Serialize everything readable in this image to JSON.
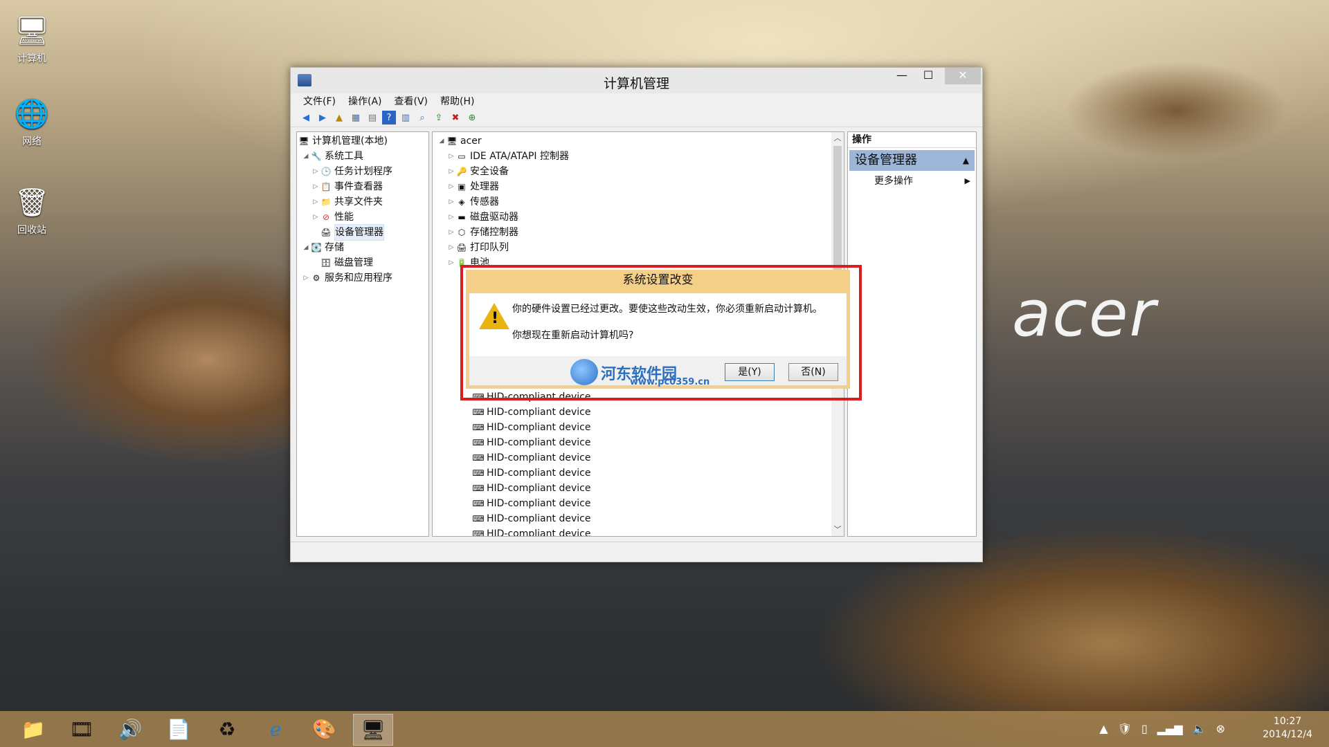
{
  "desktop": {
    "icons": [
      {
        "label": "计算机"
      },
      {
        "label": "网络"
      },
      {
        "label": "回收站"
      }
    ],
    "brand_logo": "acer"
  },
  "window": {
    "title": "计算机管理",
    "menu": [
      "文件(F)",
      "操作(A)",
      "查看(V)",
      "帮助(H)"
    ],
    "left_tree": [
      {
        "label": "计算机管理(本地)",
        "level": 0,
        "arrow": ""
      },
      {
        "label": "系统工具",
        "level": 1,
        "arrow": "◢"
      },
      {
        "label": "任务计划程序",
        "level": 2,
        "arrow": "▷"
      },
      {
        "label": "事件查看器",
        "level": 2,
        "arrow": "▷"
      },
      {
        "label": "共享文件夹",
        "level": 2,
        "arrow": "▷"
      },
      {
        "label": "性能",
        "level": 2,
        "arrow": "▷"
      },
      {
        "label": "设备管理器",
        "level": 2,
        "arrow": "",
        "selected": true
      },
      {
        "label": "存储",
        "level": 1,
        "arrow": "◢"
      },
      {
        "label": "磁盘管理",
        "level": 2,
        "arrow": ""
      },
      {
        "label": "服务和应用程序",
        "level": 1,
        "arrow": "▷"
      }
    ],
    "device_tree_root": "acer",
    "device_categories": [
      "IDE ATA/ATAPI 控制器",
      "安全设备",
      "处理器",
      "传感器",
      "磁盘驱动器",
      "存储控制器",
      "打印队列",
      "电池"
    ],
    "hid_devices": [
      "HID-compliant device",
      "HID-compliant device",
      "HID-compliant device",
      "HID-compliant device",
      "HID-compliant device",
      "HID-compliant device",
      "HID-compliant device",
      "HID-compliant device",
      "HID-compliant device",
      "HID-compliant device"
    ],
    "actions_header": "操作",
    "actions_section": "设备管理器",
    "actions_more": "更多操作"
  },
  "dialog": {
    "title": "系统设置改变",
    "message_line1": "你的硬件设置已经过更改。要使这些改动生效，你必须重新启动计算机。",
    "message_line2": "你想现在重新启动计算机吗?",
    "yes_label": "是(Y)",
    "no_label": "否(N)",
    "watermark_name": "河东软件园",
    "watermark_url": "www.pc0359.cn"
  },
  "taskbar": {
    "time": "10:27",
    "date": "2014/12/4"
  }
}
